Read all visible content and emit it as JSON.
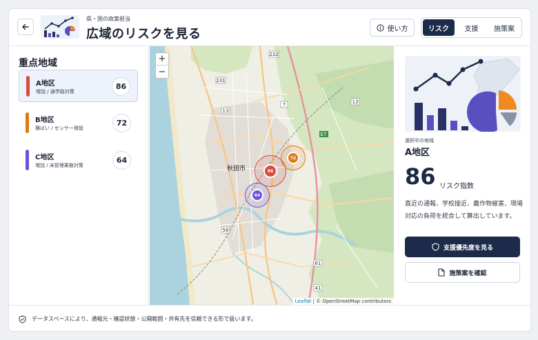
{
  "header": {
    "subtitle": "県・国の政策担当",
    "title": "広域のリスクを見る",
    "help_label": "使い方",
    "tabs": [
      {
        "label": "リスク",
        "active": true
      },
      {
        "label": "支援",
        "active": false
      },
      {
        "label": "施策案",
        "active": false
      }
    ]
  },
  "sidebar": {
    "title": "重点地域",
    "regions": [
      {
        "name": "A地区",
        "desc": "増加 / 通学路対策",
        "score": "86",
        "color": "#d94b3f",
        "selected": true
      },
      {
        "name": "B地区",
        "desc": "横ばい / センサー増設",
        "score": "72",
        "color": "#e07a10",
        "selected": false
      },
      {
        "name": "C地区",
        "desc": "増加 / 未管理果樹対策",
        "score": "64",
        "color": "#6a55d8",
        "selected": false
      }
    ]
  },
  "map": {
    "zoom_in": "+",
    "zoom_out": "−",
    "city_label": "秋田市",
    "markers": [
      {
        "label": "86",
        "color": "#d94b3f"
      },
      {
        "label": "72",
        "color": "#e07a10"
      },
      {
        "label": "64",
        "color": "#6a55d8"
      }
    ],
    "attribution_leaflet": "Leaflet",
    "attribution_rest": "| © OpenStreetMap contributors",
    "road_labels": [
      "231",
      "232",
      "13",
      "7",
      "E7",
      "13",
      "56",
      "61",
      "41"
    ]
  },
  "detail": {
    "selected_label": "選択中の地域",
    "region_name": "A地区",
    "score": "86",
    "score_label": "リスク指数",
    "description": "直近の通報、学校接近、農作物被害、現場対応の負荷を統合して算出しています。",
    "primary_action": "支援優先度を見る",
    "secondary_action": "施策案を確認"
  },
  "footer": {
    "text": "データスペースにより、通報元・確認状態・公開範囲・共有先を信頼できる形で扱います。"
  },
  "colors": {
    "navy": "#1c2b4a",
    "red": "#d94b3f",
    "orange": "#e07a10",
    "purple": "#6a55d8"
  }
}
